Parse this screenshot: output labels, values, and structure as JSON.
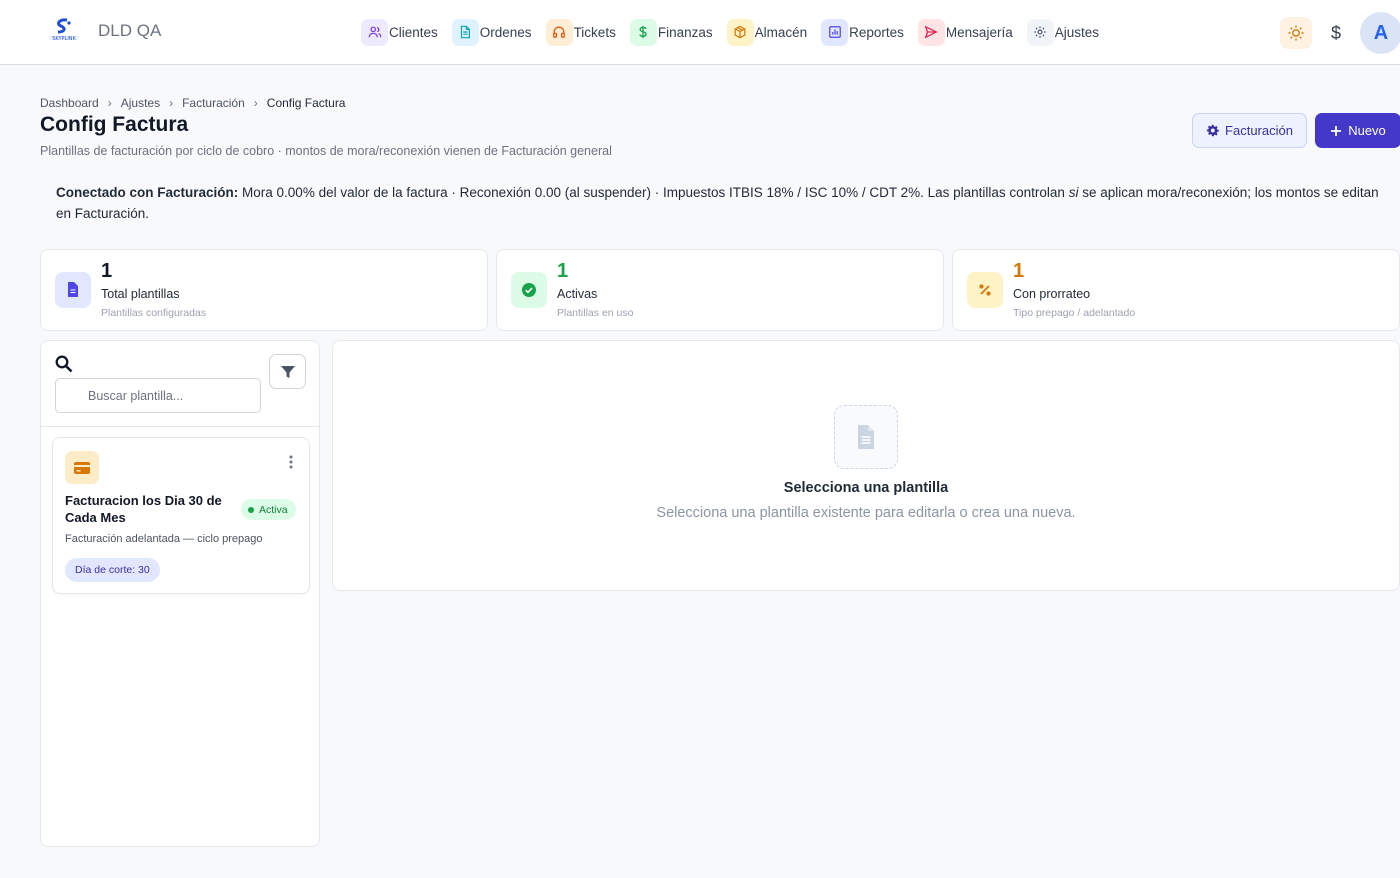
{
  "app": {
    "title": "DLD QA",
    "logo_text": "SKYPLINK"
  },
  "nav": [
    {
      "label": "Clientes",
      "icon": "users-icon",
      "bg": "#ede9fe",
      "fg": "#7c3aed"
    },
    {
      "label": "Ordenes",
      "icon": "document-icon",
      "bg": "#e0f2fe",
      "fg": "#0ea5b7"
    },
    {
      "label": "Tickets",
      "icon": "headset-icon",
      "bg": "#ffedd5",
      "fg": "#ea580c"
    },
    {
      "label": "Finanzas",
      "icon": "dollar-icon",
      "bg": "#dcfce7",
      "fg": "#16a34a"
    },
    {
      "label": "Almacén",
      "icon": "box-icon",
      "bg": "#fef3c7",
      "fg": "#d97706"
    },
    {
      "label": "Reportes",
      "icon": "chart-icon",
      "bg": "#e0e7ff",
      "fg": "#4f46e5"
    },
    {
      "label": "Mensajería",
      "icon": "send-icon",
      "bg": "#ffe4e6",
      "fg": "#e11d48"
    },
    {
      "label": "Ajustes",
      "icon": "gear-icon",
      "bg": "#f1f5f9",
      "fg": "#475569"
    }
  ],
  "header_right": {
    "currency_symbol": "$",
    "avatar_initial": "A"
  },
  "breadcrumb": [
    "Dashboard",
    "Ajustes",
    "Facturación",
    "Config Factura"
  ],
  "page": {
    "title": "Config Factura",
    "subtitle": "Plantillas de facturación por ciclo de cobro · montos de mora/reconexión vienen de Facturación general",
    "btn_facturacion": "Facturación",
    "btn_nuevo": "Nuevo"
  },
  "notice": {
    "lead": "Conectado con Facturación:",
    "text_1": " Mora 0.00% del valor de la factura · Reconexión 0.00 (al suspender) · Impuestos ITBIS 18% / ISC 10% / CDT 2%. Las plantillas controlan ",
    "emph": "si",
    "text_2": " se aplican mora/reconexión; los montos se editan en Facturación."
  },
  "stats": [
    {
      "value": "1",
      "label": "Total plantillas",
      "sub": "Plantillas configuradas",
      "icon": "document-icon",
      "color": "#111827",
      "icon_bg": "#e0e7ff",
      "icon_fg": "#4f46e5"
    },
    {
      "value": "1",
      "label": "Activas",
      "sub": "Plantillas en uso",
      "icon": "check-circle-icon",
      "color": "#16a34a",
      "icon_bg": "#dcfce7",
      "icon_fg": "#16a34a"
    },
    {
      "value": "1",
      "label": "Con prorrateo",
      "sub": "Tipo prepago / adelantado",
      "icon": "percent-icon",
      "color": "#d97706",
      "icon_bg": "#fef3c7",
      "icon_fg": "#d97706"
    }
  ],
  "search": {
    "placeholder": "Buscar plantilla..."
  },
  "templates": [
    {
      "name": "Facturacion los Dia 30 de Cada Mes",
      "status": "Activa",
      "description": "Facturación adelantada — ciclo prepago",
      "chip": "Día de corte: 30"
    }
  ],
  "empty_state": {
    "title": "Selecciona una plantilla",
    "subtitle": "Selecciona una plantilla existente para editarla o crea una nueva."
  }
}
